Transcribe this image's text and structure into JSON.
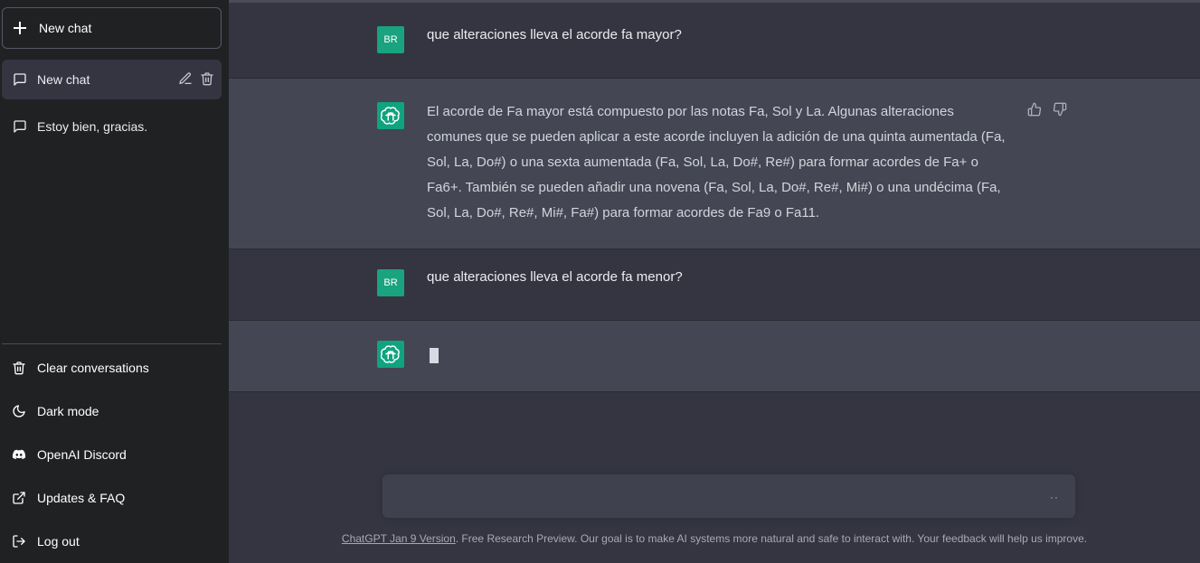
{
  "sidebar": {
    "new_chat_label": "New chat",
    "history": [
      {
        "label": "New chat",
        "active": true
      },
      {
        "label": "Estoy bien, gracias.",
        "active": false
      }
    ],
    "menu": [
      {
        "label": "Clear conversations",
        "icon": "trash-icon"
      },
      {
        "label": "Dark mode",
        "icon": "moon-icon"
      },
      {
        "label": "OpenAI Discord",
        "icon": "discord-icon"
      },
      {
        "label": "Updates & FAQ",
        "icon": "external-link-icon"
      },
      {
        "label": "Log out",
        "icon": "logout-icon"
      }
    ]
  },
  "conversation": {
    "user_initials": "BR",
    "messages": [
      {
        "role": "user",
        "text": "que alteraciones lleva el acorde fa mayor?"
      },
      {
        "role": "assistant",
        "text": "El acorde de Fa mayor está compuesto por las notas Fa, Sol y La. Algunas alteraciones comunes que se pueden aplicar a este acorde incluyen la adición de una quinta aumentada (Fa, Sol, La, Do#) o una sexta aumentada (Fa, Sol, La, Do#, Re#) para formar acordes de Fa+ o Fa6+. También se pueden añadir una novena (Fa, Sol, La, Do#, Re#, Mi#) o una undécima (Fa, Sol, La, Do#, Re#, Mi#, Fa#) para formar acordes de Fa9 o Fa11."
      },
      {
        "role": "user",
        "text": "que alteraciones lleva el acorde fa menor?"
      },
      {
        "role": "assistant",
        "text": ""
      }
    ]
  },
  "input": {
    "value": "",
    "loading_indicator": "··"
  },
  "footer": {
    "version_link": "ChatGPT Jan 9 Version",
    "text": ". Free Research Preview. Our goal is to make AI systems more natural and safe to interact with. Your feedback will help us improve."
  },
  "colors": {
    "sidebar_bg": "#202123",
    "main_bg": "#343541",
    "assistant_bg": "#444654",
    "accent": "#10a37f"
  }
}
